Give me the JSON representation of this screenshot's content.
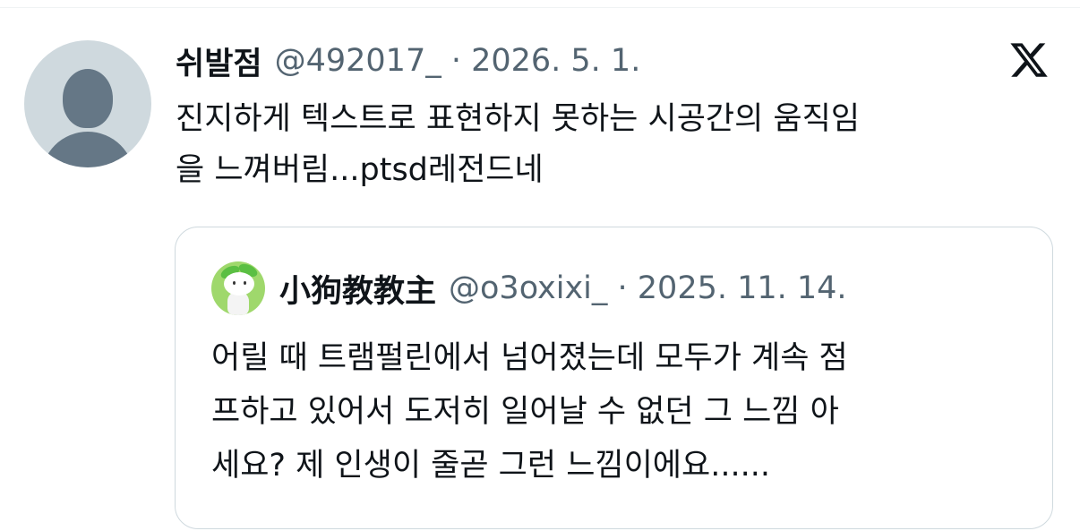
{
  "tweet": {
    "author_name": "쉬발점",
    "meta": "@492017_ · 2026. 5. 1.",
    "text": "진지하게 텍스트로 표현하지 못하는 시공간의 움직임\n을 느껴버림...ptsd레전드네",
    "platform_icon": "x-logo-icon",
    "avatar_icon": "default-avatar-icon"
  },
  "quote": {
    "author_name": "小狗教教主",
    "meta": "@o3oxixi_ · 2025. 11. 14.",
    "text": "어릴 때 트램펄린에서 넘어졌는데 모두가 계속 점\n프하고 있어서 도저히 일어날 수 없던 그 느낌 아\n세요? 제 인생이 줄곧 그런 느낌이에요......",
    "avatar_icon": "character-avatar-icon"
  },
  "colors": {
    "text": "#0f1419",
    "secondary": "#536471",
    "border": "#cfd9de",
    "avatar_bg": "#cfd9de"
  }
}
